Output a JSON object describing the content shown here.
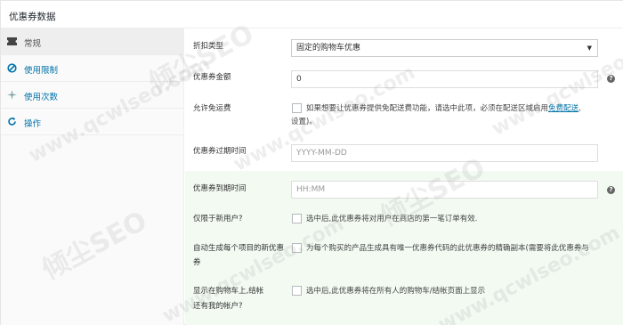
{
  "panel": {
    "title": "优惠券数据"
  },
  "tabs": [
    {
      "label": "常规",
      "icon": "ticket-icon"
    },
    {
      "label": "使用限制",
      "icon": "no-entry-icon"
    },
    {
      "label": "使用次数",
      "icon": "sparkle-icon"
    },
    {
      "label": "操作",
      "icon": "refresh-icon"
    }
  ],
  "fields": {
    "discount_type": {
      "label": "折扣类型",
      "value": "固定的购物车优惠"
    },
    "amount": {
      "label": "优惠券金额",
      "value": "0"
    },
    "free_shipping": {
      "label": "允许免运费",
      "desc_line1": "如果想要让优惠券提供免配送费功能，请选中此项，必须在配送区域启用",
      "link": "免费配送",
      "desc_line2": "设置)。"
    },
    "expiry_date": {
      "label": "优惠券过期时间",
      "placeholder": "YYYY-MM-DD"
    },
    "expiry_time": {
      "label": "优惠券到期时间",
      "placeholder": "HH:MM"
    },
    "new_users": {
      "label": "仅限于新用户?",
      "desc": "选中后,此优惠券将对用户在商店的第一笔订单有效."
    },
    "auto_generate": {
      "label_line1": "自动生成每个项目的新优惠",
      "label_line2": "券",
      "desc": "为每个购买的产品生成具有唯一优惠券代码的此优惠券的精确副本(需要将此优惠券与"
    },
    "show_cart": {
      "label_line1": "显示在购物车上,结帐",
      "label_line2": "还有我的帐户?",
      "desc": "选中后,此优惠券将在所有人的购物车/结帐页面上显示"
    }
  },
  "watermarks": [
    "倾尘SEO",
    "www.qcwlseo.com"
  ]
}
